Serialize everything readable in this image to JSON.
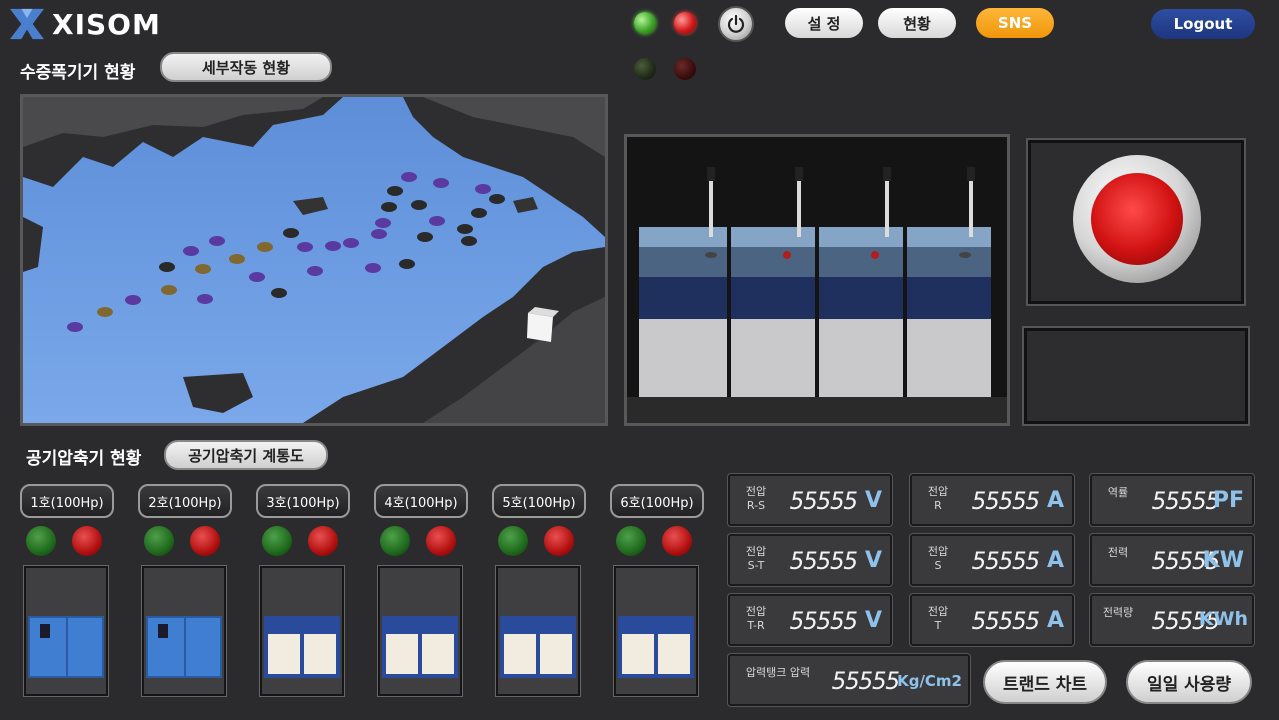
{
  "header": {
    "logo_text": "XISOM",
    "settings_label": "설 정",
    "status_label": "현황",
    "sns_label": "SNS",
    "logout_label": "Logout"
  },
  "water_section": {
    "title": "수증폭기기 현황",
    "detail_button": "세부작동 현황"
  },
  "compressor_section": {
    "title": "공기압축기 현황",
    "diagram_button": "공기압축기 계통도",
    "units": [
      {
        "label": "1호(100Hp)",
        "model": "blue"
      },
      {
        "label": "2호(100Hp)",
        "model": "blue"
      },
      {
        "label": "3호(100Hp)",
        "model": "white"
      },
      {
        "label": "4호(100Hp)",
        "model": "white"
      },
      {
        "label": "5호(100Hp)",
        "model": "white"
      },
      {
        "label": "6호(100Hp)",
        "model": "white"
      }
    ]
  },
  "meters": {
    "v_rs": {
      "label1": "전압",
      "label2": "R-S",
      "value": "55555",
      "unit": "V"
    },
    "v_st": {
      "label1": "전압",
      "label2": "S-T",
      "value": "55555",
      "unit": "V"
    },
    "v_tr": {
      "label1": "전압",
      "label2": "T-R",
      "value": "55555",
      "unit": "V"
    },
    "a_r": {
      "label1": "전압",
      "label2": "R",
      "value": "55555",
      "unit": "A"
    },
    "a_s": {
      "label1": "전압",
      "label2": "S",
      "value": "55555",
      "unit": "A"
    },
    "a_t": {
      "label1": "전압",
      "label2": "T",
      "value": "55555",
      "unit": "A"
    },
    "pf": {
      "label1": "역률",
      "value": "55555",
      "unit": "PF"
    },
    "kw": {
      "label1": "전력",
      "value": "55555",
      "unit": "KW"
    },
    "kwh": {
      "label1": "전력량",
      "value": "55555",
      "unit": "KWh"
    },
    "tank": {
      "label1": "압력탱크 압력",
      "value": "55555",
      "unit": "Kg/Cm2"
    }
  },
  "actions": {
    "trend_chart": "트랜드 차트",
    "daily_usage": "일일 사용량"
  },
  "colors": {
    "background": "#2b2b2d",
    "water": "#6f9fe0",
    "accent_orange": "#f0960a",
    "accent_blue": "#1d357e",
    "unit_blue": "#8fc2ea"
  }
}
